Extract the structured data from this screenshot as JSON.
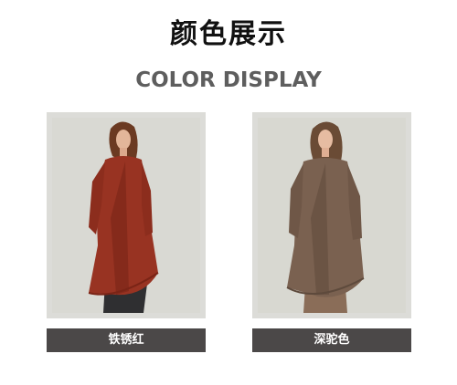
{
  "header": {
    "title_cn": "颜色展示",
    "title_en": "COLOR DISPLAY"
  },
  "colors": [
    {
      "name": "铁锈红",
      "swatch_hex": "#9b3421",
      "image_subject": "model-wearing-rust-red-cardigan"
    },
    {
      "name": "深驼色",
      "swatch_hex": "#7b6350",
      "image_subject": "model-wearing-dark-camel-cardigan"
    }
  ],
  "theme": {
    "label_bg": "#4b4848",
    "frame_bg": "#dcdcd8"
  }
}
